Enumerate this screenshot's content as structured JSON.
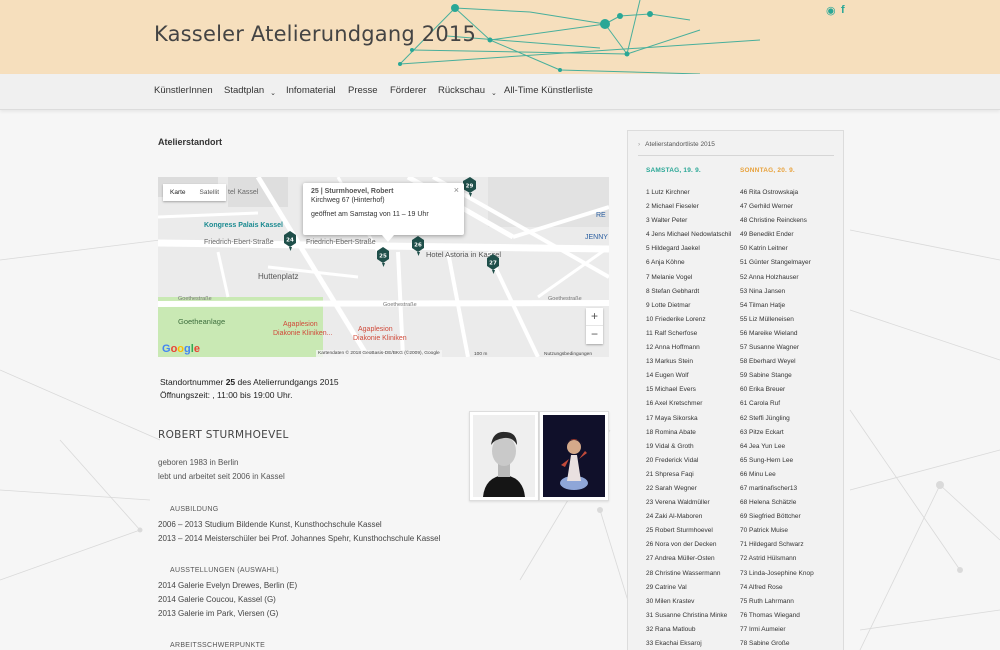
{
  "site": {
    "title": "Kasseler Atelierundgang 2015",
    "accent": "#2aa796",
    "social": {
      "rss_icon": "rss-icon",
      "facebook_icon": "facebook-icon",
      "facebook_glyph": "f",
      "rss_glyph": "◉"
    }
  },
  "nav": {
    "items": [
      {
        "label": "KünstlerInnen",
        "dropdown": false
      },
      {
        "label": "Stadtplan",
        "dropdown": true
      },
      {
        "label": "Infomaterial",
        "dropdown": false
      },
      {
        "label": "Presse",
        "dropdown": false
      },
      {
        "label": "Förderer",
        "dropdown": false
      },
      {
        "label": "Rückschau",
        "dropdown": true
      },
      {
        "label": "All-Time Künstlerliste",
        "dropdown": false
      }
    ],
    "caret": "⌄"
  },
  "main": {
    "page_title": "Atelierstandort",
    "map": {
      "type_karte": "Karte",
      "type_satellit": "Satellit",
      "popup": {
        "title": "25 | Sturmhoevel, Robert",
        "address": "Kirchweg 67 (Hinterhof)",
        "opening": "geöffnet am Samstag von 11 – 19 Uhr",
        "close": "×"
      },
      "zoom_in": "+",
      "zoom_out": "−",
      "footer": "Kartendaten © 2018 GeoBasis-DE/BKG (©2009), Google",
      "scale": "100 m",
      "terms": "Nutzungsbedingungen",
      "google": "Google",
      "labels": {
        "kongress": "Kongress Palais Kassel",
        "tel_kassel": "tel Kassel",
        "fe_strasse_1": "Friedrich-Ebert-Straße",
        "fe_strasse_2": "Friedrich-Ebert-Straße",
        "huttenplatz": "Huttenplatz",
        "hotel_astoria": "Hotel Astoria in Kassel",
        "jenny": "JENNY",
        "goetheanlage": "Goetheanlage",
        "agaplesion_1": "Agaplesion",
        "agaplesion_2": "Diakonie Kliniken...",
        "agaplesion_3": "Agaplesion",
        "agaplesion_4": "Diakonie Kliniken",
        "goethestr_1": "Goethestraße",
        "goethestr_2": "Goethestraße",
        "goethestr_3": "Goethestraße",
        "re": "RE"
      },
      "markers": [
        "29",
        "24",
        "25",
        "26",
        "27"
      ]
    },
    "standort": {
      "prefix": "Standortnummer",
      "number": "25",
      "suffix": "des Atelierrundgangs 2015",
      "opening_line": "Öffnungszeit: , 11:00 bis 19:00 Uhr."
    },
    "artist": {
      "name": "ROBERT STURMHOEVEL",
      "bio": [
        "geboren 1983 in Berlin",
        "lebt und arbeitet seit 2006 in Kassel"
      ],
      "sections": [
        {
          "heading": "AUSBILDUNG",
          "lines": [
            "2006 – 2013 Studium Bildende Kunst, Kunsthochschule Kassel",
            "2013 – 2014 Meisterschüler bei Prof. Johannes Spehr, Kunsthochschule Kassel"
          ]
        },
        {
          "heading": "AUSSTELLUNGEN (AUSWAHL)",
          "lines": [
            "2014 Galerie Evelyn Drewes, Berlin (E)",
            "2014 Galerie Coucou, Kassel (G)",
            "2013 Galerie im Park, Viersen (G)"
          ]
        },
        {
          "heading": "ARBEITSSCHWERPUNKTE",
          "lines": []
        }
      ]
    }
  },
  "sidebar": {
    "title": "Atelierstandortliste 2015",
    "saturday_label": "SAMSTAG, 19. 9.",
    "sunday_label": "SONNTAG, 20. 9.",
    "saturday_color": "#2aa796",
    "sunday_color": "#e8a23c",
    "saturday": [
      "1 Lutz Kirchner",
      "2 Michael Fieseler",
      "3 Walter Peter",
      "4 Jens Michael Nedowlatschil",
      "5 Hildegard Jaekel",
      "6 Anja Köhne",
      "7 Melanie Vogel",
      "8 Stefan Gebhardt",
      "9 Lotte Dietmar",
      "10 Friederike Lorenz",
      "11 Ralf Scherfose",
      "12 Anna Hoffmann",
      "13 Markus Stein",
      "14 Eugen Wolf",
      "15 Michael Evers",
      "16 Axel Kretschmer",
      "17 Maya Sikorska",
      "18 Romina Abate",
      "19 Vidal & Groth",
      "20 Frederick Vidal",
      "21 Shpresa Faqi",
      "22 Sarah Wegner",
      "23 Verena Waldmüller",
      "24 Zaki Al-Maboren",
      "25 Robert Sturmhoevel",
      "26 Nora von der Decken",
      "27 Andrea Müller-Osten",
      "28 Christine Wassermann",
      "29 Catrine Val",
      "30 Milen Krastev",
      "31 Susanne Christina Minke",
      "32 Rana Matloub",
      "33 Ekachai Eksaroj"
    ],
    "sunday": [
      "46 Rita Ostrowskaja",
      "47 Gerhild Werner",
      "48 Christine Reinckens",
      "49 Benedikt Ender",
      "50 Katrin Leitner",
      "51 Günter Stangelmayer",
      "52 Anna Holzhauser",
      "53 Nina Jansen",
      "54 Tilman Hatje",
      "55 Liz Mülleneisen",
      "56 Mareike Wieland",
      "57 Susanne Wagner",
      "58 Eberhard Weyel",
      "59 Sabine Stange",
      "60 Erika Breuer",
      "61 Carola Ruf",
      "62 Steffi Jüngling",
      "63 Pitze Eckart",
      "64 Jea Yun Lee",
      "65 Sung-Hern Lee",
      "66 Minu Lee",
      "67 martinafischer13",
      "68 Helena Schätzle",
      "69 Siegfried Böttcher",
      "70 Patrick Muise",
      "71 Hildegard Schwarz",
      "72 Astrid Hülsmann",
      "73 Linda-Josephine Knop",
      "74 Alfred Rose",
      "75 Ruth Lahrmann",
      "76 Thomas Wiegand",
      "77 Irmi Aumeier",
      "78 Sabine Große"
    ]
  }
}
